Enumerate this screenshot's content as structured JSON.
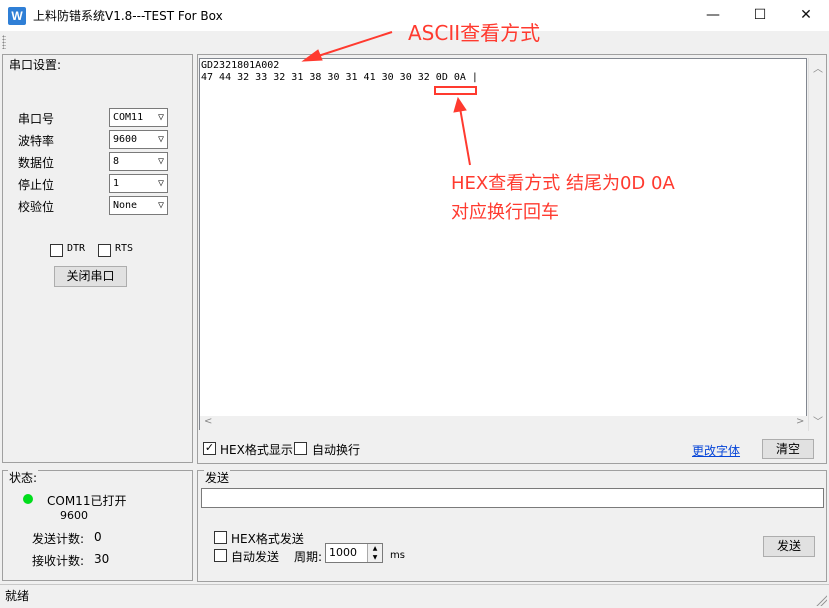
{
  "window": {
    "title": "上料防错系统V1.8---TEST For Box",
    "icon_letter": "W",
    "controls": {
      "minimize": "—",
      "maximize": "☐",
      "close": "✕"
    }
  },
  "serial_settings": {
    "title": "串口设置",
    "fields": [
      {
        "label": "串口号",
        "value": "COM11"
      },
      {
        "label": "波特率",
        "value": "9600"
      },
      {
        "label": "数据位",
        "value": "8"
      },
      {
        "label": "停止位",
        "value": "1"
      },
      {
        "label": "校验位",
        "value": "None"
      }
    ],
    "dtr_label": "DTR",
    "rts_label": "RTS",
    "close_port_label": "关闭串口"
  },
  "receive": {
    "ascii_line": "GD2321801A002",
    "hex_line": "47 44 32 33 32 31 38 30 31 41 30 30 32 0D 0A |",
    "hex_display_label": "HEX格式显示",
    "hex_display_checked": true,
    "auto_wrap_label": "自动换行",
    "auto_wrap_checked": false,
    "change_font_label": "更改字体",
    "clear_label": "清空"
  },
  "status": {
    "title": "状态",
    "port_status": "COM11已打开",
    "baud": "9600",
    "sent_count_label": "发送计数:",
    "sent_count": "0",
    "recv_count_label": "接收计数:",
    "recv_count": "30",
    "indicator_color": "#00dd1c"
  },
  "send": {
    "title": "发送",
    "input_value": "",
    "hex_send_label": "HEX格式发送",
    "auto_send_label": "自动发送",
    "period_label": "周期:",
    "period_value": "1000",
    "period_unit": "ms",
    "send_button_label": "发送"
  },
  "statusbar": {
    "text": "就绪"
  },
  "annotations": {
    "ascii_note": "ASCII查看方式",
    "hex_note_line1": "HEX查看方式 结尾为0D  0A",
    "hex_note_line2": "对应换行回车",
    "color": "#ff3a2f"
  }
}
